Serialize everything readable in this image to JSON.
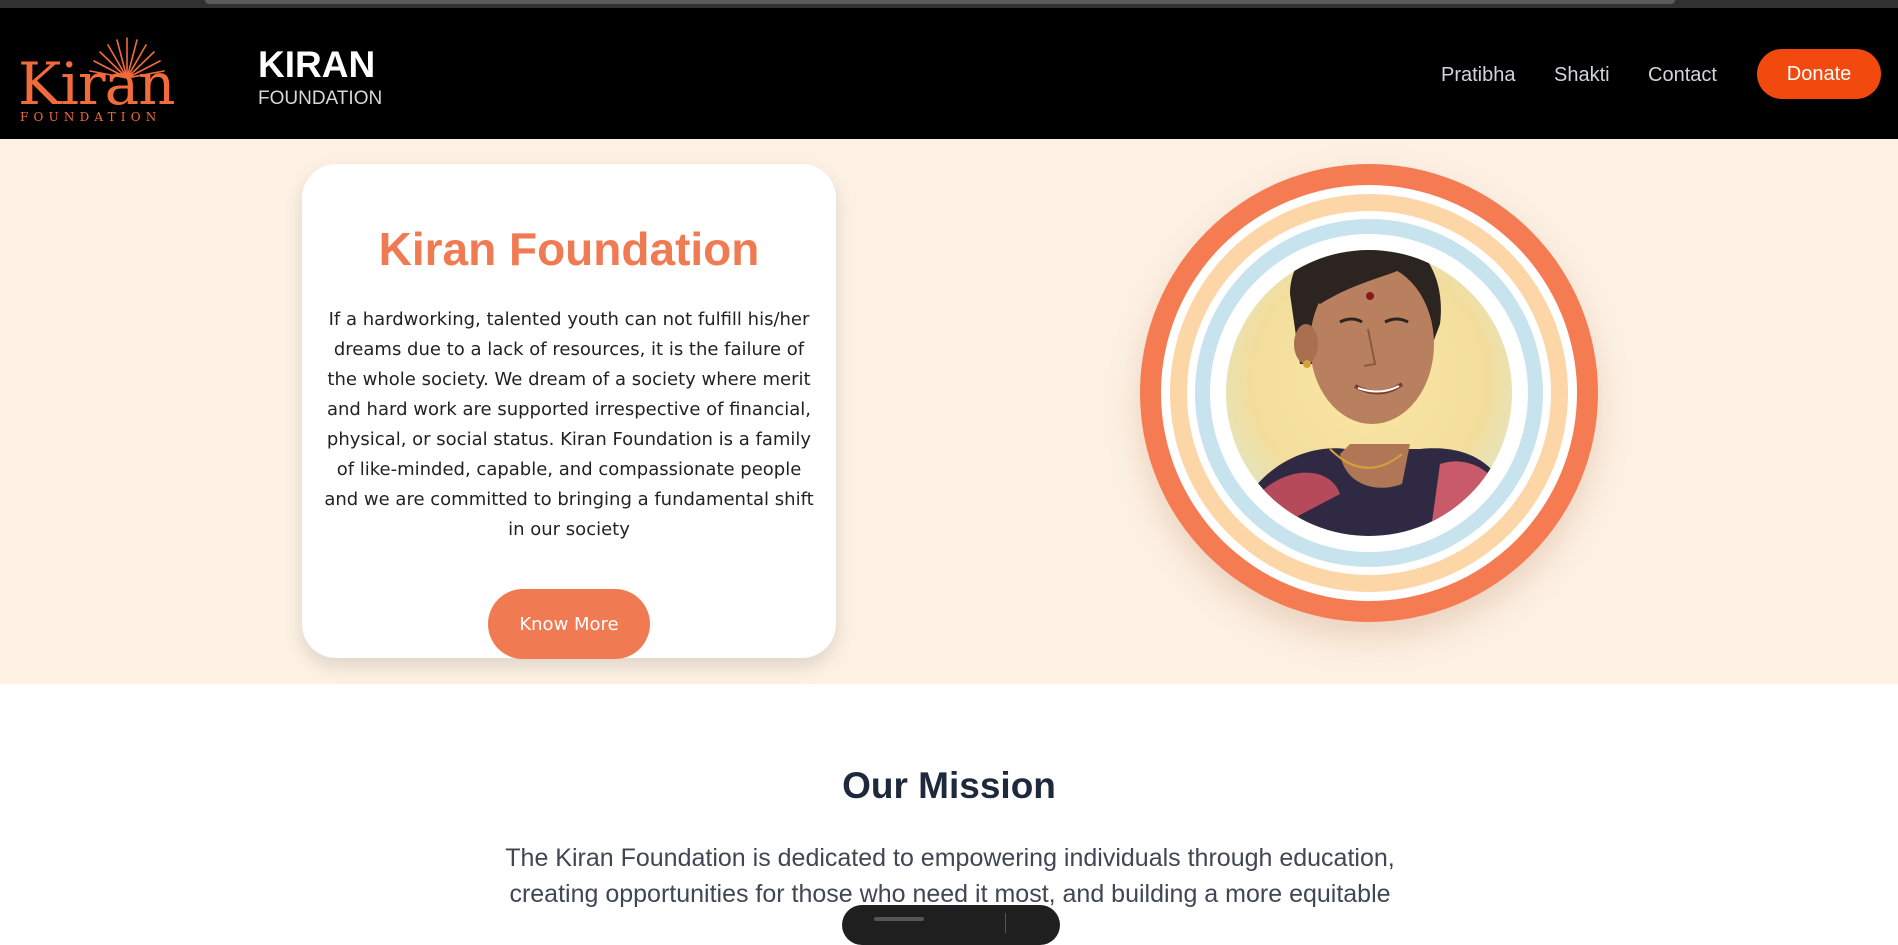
{
  "logo": {
    "word": "Kiran",
    "subtitle": "FOUNDATION"
  },
  "brand": {
    "title": "KIRAN",
    "subtitle": "FOUNDATION"
  },
  "nav": {
    "items": [
      "Pratibha",
      "Shakti",
      "Contact"
    ],
    "donate": "Donate"
  },
  "hero": {
    "title": "Kiran Foundation",
    "description": "If a hardworking, talented youth can not fulfill his/her dreams due to a lack of resources, it is the failure of the whole society. We dream of a society where merit and hard work are supported irrespective of financial, physical, or social status. Kiran Foundation is a family of like-minded, capable, and compassionate people and we are committed to bringing a fundamental shift in our society",
    "button": "Know More"
  },
  "mission": {
    "title": "Our Mission",
    "text": "The Kiran Foundation is dedicated to empowering individuals through education, creating opportunities for those who need it most, and building a more equitable"
  },
  "colors": {
    "accent": "#f07a52",
    "donate": "#f24a0e",
    "hero_bg": "#fdf1e4",
    "ring_outer": "#f47b52",
    "ring_peach": "#fdd6a8",
    "ring_blue": "#c7e3ee"
  },
  "icons": {
    "photo": "woman-portrait-photo"
  }
}
